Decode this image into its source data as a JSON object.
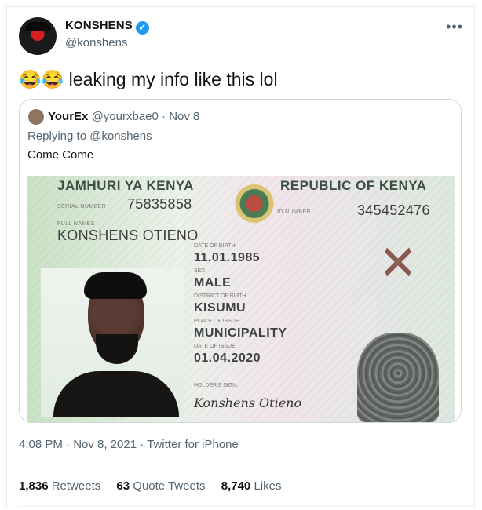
{
  "tweet": {
    "author_name": "KONSHENS",
    "author_handle": "@konshens",
    "more_icon": "more-options-icon",
    "text": "😂😂 leaking my info like this lol",
    "meta": "4:08 PM · Nov 8, 2021 · Twitter for iPhone",
    "stats": {
      "retweets_value": "1,836",
      "retweets_label": "Retweets",
      "quote_tweets_value": "63",
      "quote_tweets_label": "Quote Tweets",
      "likes_value": "8,740",
      "likes_label": "Likes"
    }
  },
  "quoted_tweet": {
    "author_name": "YourEx",
    "author_handle": "@yourxbae0",
    "date": "· Nov 8",
    "reply_context": "Replying to @konshens",
    "text": "Come Come"
  },
  "id_card": {
    "header_left": "JAMHURI YA KENYA",
    "header_right": "REPUBLIC OF KENYA",
    "serial_label": "SERIAL NUMBER",
    "serial_value": "75835858",
    "id_label": "ID NUMBER",
    "id_value": "345452476",
    "full_names_label": "FULL NAMES",
    "full_name": "KONSHENS OTIENO",
    "dob_label": "DATE OF BIRTH",
    "dob": "11.01.1985",
    "sex_label": "SEX",
    "sex": "MALE",
    "district_label": "DISTRICT OF BIRTH",
    "district": "KISUMU",
    "place_label": "PLACE OF ISSUE",
    "place": "MUNICIPALITY",
    "issue_label": "DATE OF ISSUE",
    "issue_date": "01.04.2020",
    "holder_sign_label": "HOLDER'S SIGN.",
    "signature": "Konshens Otieno"
  }
}
